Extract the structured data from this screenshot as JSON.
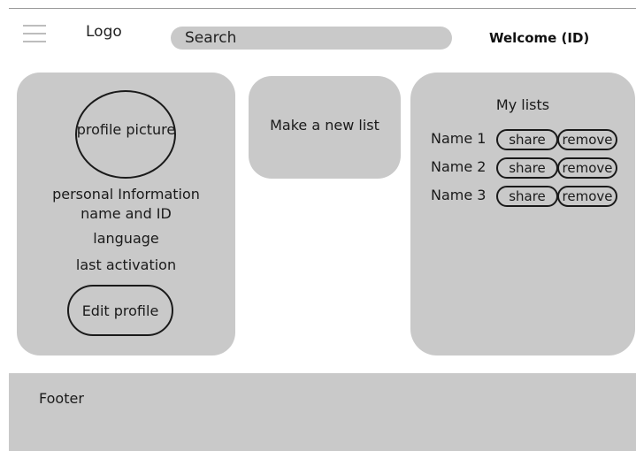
{
  "header": {
    "logo": "Logo",
    "search_placeholder": "Search",
    "welcome": "Welcome (ID)"
  },
  "profile": {
    "picture_label": "profile picture",
    "personal_info": "personal Information",
    "name_id": "name and ID",
    "language": "language",
    "last_activation": "last activation",
    "edit_label": "Edit profile"
  },
  "new_list": {
    "label": "Make a new list"
  },
  "my_lists": {
    "title": "My lists",
    "items": [
      {
        "name": "Name 1",
        "share": "share",
        "remove": "remove"
      },
      {
        "name": "Name 2",
        "share": "share",
        "remove": "remove"
      },
      {
        "name": "Name 3",
        "share": "share",
        "remove": "remove"
      }
    ]
  },
  "footer": {
    "label": "Footer"
  }
}
